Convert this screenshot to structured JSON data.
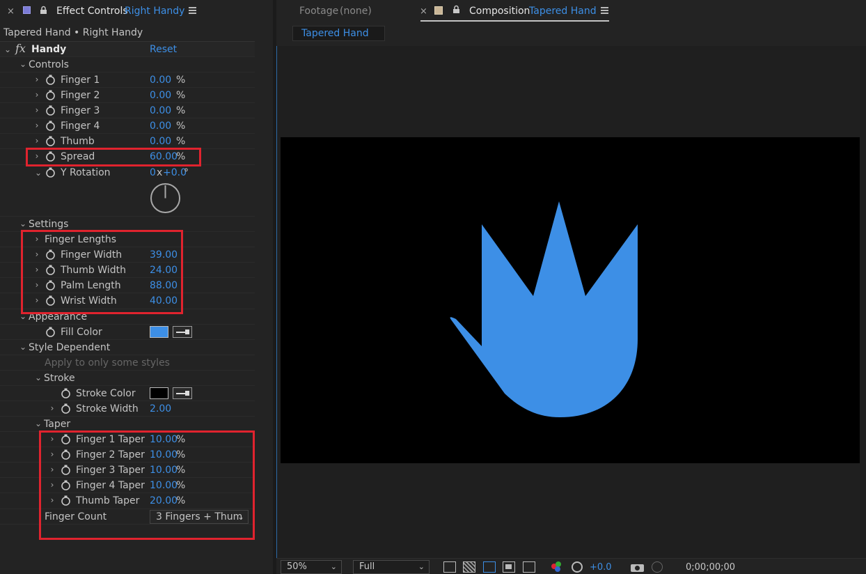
{
  "left_panel": {
    "tab_prefix": "Effect Controls",
    "tab_layer": "Right Handy",
    "layer_path": "Tapered Hand • Right Handy",
    "effect": {
      "fx": "fx",
      "name": "Handy",
      "reset": "Reset"
    },
    "controls": {
      "label": "Controls",
      "fingers": [
        {
          "label": "Finger 1",
          "value": "0.00",
          "unit": "%"
        },
        {
          "label": "Finger 2",
          "value": "0.00",
          "unit": "%"
        },
        {
          "label": "Finger 3",
          "value": "0.00",
          "unit": "%"
        },
        {
          "label": "Finger 4",
          "value": "0.00",
          "unit": "%"
        },
        {
          "label": "Thumb",
          "value": "0.00",
          "unit": "%"
        },
        {
          "label": "Spread",
          "value": "60.00",
          "unit": "%"
        }
      ],
      "y_rotation": {
        "label": "Y Rotation",
        "turns": "0",
        "x": "x",
        "offset": "+0.0",
        "deg": "°"
      }
    },
    "settings": {
      "label": "Settings",
      "finger_lengths": "Finger Lengths",
      "items": [
        {
          "label": "Finger Width",
          "value": "39.00"
        },
        {
          "label": "Thumb Width",
          "value": "24.00"
        },
        {
          "label": "Palm Length",
          "value": "88.00"
        },
        {
          "label": "Wrist Width",
          "value": "40.00"
        }
      ]
    },
    "appearance": {
      "label": "Appearance",
      "fill_color_label": "Fill Color",
      "fill_color": "#3d8fe6"
    },
    "style_dependent": {
      "label": "Style Dependent",
      "hint": "Apply to only some styles",
      "stroke": {
        "label": "Stroke",
        "color_label": "Stroke Color",
        "color": "#000000",
        "width_label": "Stroke Width",
        "width_value": "2.00"
      },
      "taper": {
        "label": "Taper",
        "items": [
          {
            "label": "Finger 1 Taper",
            "value": "10.00",
            "unit": "%"
          },
          {
            "label": "Finger 2 Taper",
            "value": "10.00",
            "unit": "%"
          },
          {
            "label": "Finger 3 Taper",
            "value": "10.00",
            "unit": "%"
          },
          {
            "label": "Finger 4 Taper",
            "value": "10.00",
            "unit": "%"
          },
          {
            "label": "Thumb Taper",
            "value": "20.00",
            "unit": "%"
          }
        ]
      },
      "finger_count": {
        "label": "Finger Count",
        "value": "3 Fingers + Thum"
      }
    }
  },
  "right_panel": {
    "footage_tab": "Footage",
    "footage_value": "(none)",
    "comp_tab_prefix": "Composition",
    "comp_tab_name": "Tapered Hand",
    "comp_subtab": "Tapered Hand",
    "hand_color": "#3d8fe6",
    "bottom": {
      "zoom": "50%",
      "resolution": "Full",
      "exposure": "+0.0",
      "timecode": "0;00;00;00"
    }
  },
  "colors": {
    "accent": "#3d8fe6",
    "highlight_box": "#e0232e"
  }
}
